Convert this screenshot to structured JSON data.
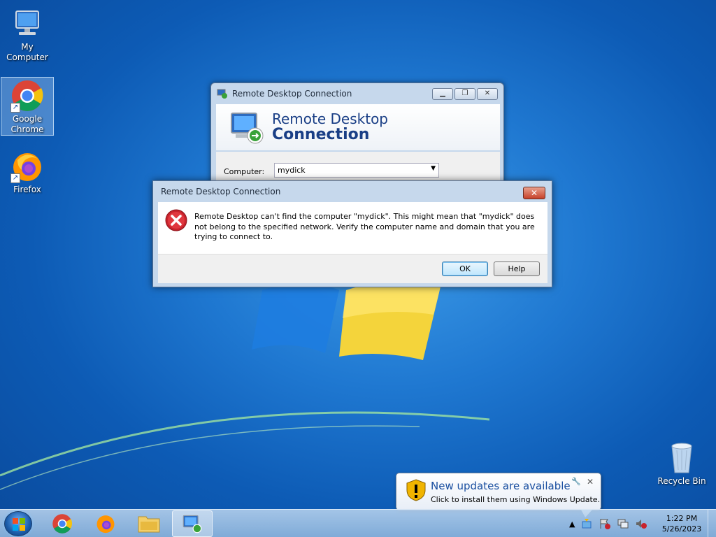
{
  "desktop": {
    "icons": [
      {
        "label": "My Computer",
        "icon": "computer-icon"
      },
      {
        "label": "Google Chrome",
        "icon": "chrome-icon",
        "selected": true
      },
      {
        "label": "Firefox",
        "icon": "firefox-icon"
      },
      {
        "label": "Recycle Bin",
        "icon": "recycle-bin-icon"
      }
    ]
  },
  "rdc_window": {
    "title": "Remote Desktop Connection",
    "banner_line1": "Remote Desktop",
    "banner_line2": "Connection",
    "computer_label": "Computer:",
    "computer_value": "mydick",
    "buttons": [
      "minimize",
      "restore",
      "close"
    ]
  },
  "error_dialog": {
    "title": "Remote Desktop Connection",
    "message": "Remote Desktop can't find the computer \"mydick\". This might mean that \"mydick\" does not belong to the specified network.  Verify the computer name and domain that you are trying to connect to.",
    "ok_label": "OK",
    "help_label": "Help",
    "close_glyph": "✕"
  },
  "notification": {
    "title": "New updates are available",
    "subtitle": "Click to install them using Windows Update.",
    "close_glyph": "✕"
  },
  "taskbar": {
    "items": [
      "chrome",
      "firefox",
      "file-explorer",
      "remote-desktop"
    ],
    "active_item": "remote-desktop",
    "clock_time": "1:22 PM",
    "clock_date": "5/26/2023"
  },
  "colors": {
    "banner_text": "#1a3f86",
    "error_red": "#c8232c",
    "title_blue": "#1a4fa0"
  }
}
